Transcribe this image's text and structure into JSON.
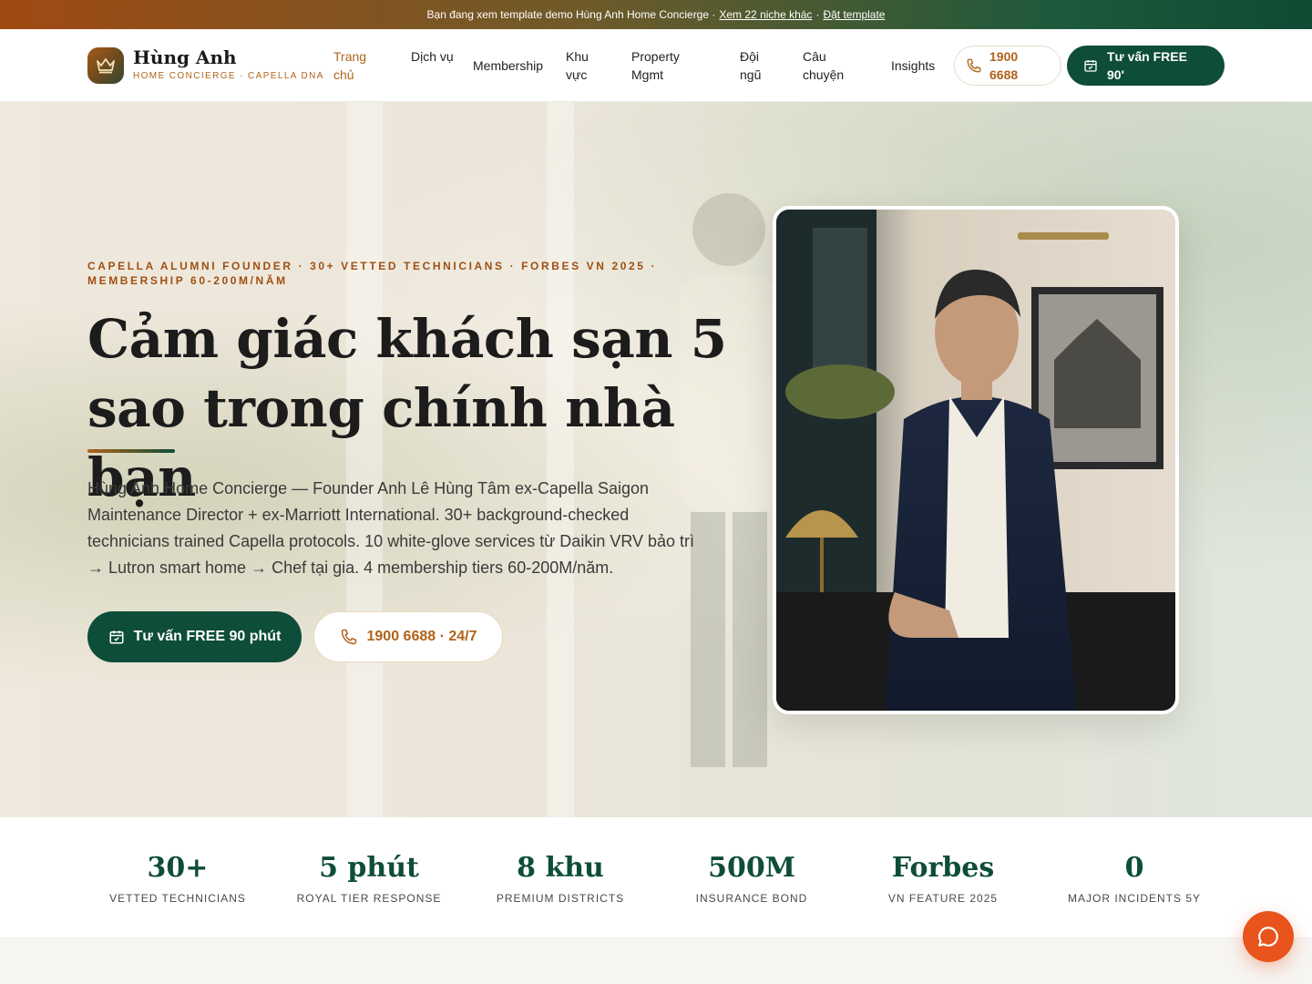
{
  "banner": {
    "text": "Bạn đang xem template demo Hùng Anh Home Concierge ·",
    "link1": "Xem 22 niche khác",
    "sep": "·",
    "link2": "Đặt template"
  },
  "brand": {
    "name": "Hùng Anh",
    "subtitle": "HOME CONCIERGE · CAPELLA DNA",
    "icon": "crown-icon"
  },
  "nav": {
    "items": [
      {
        "label": "Trang chủ",
        "active": true
      },
      {
        "label": "Dịch vụ"
      },
      {
        "label": "Membership"
      },
      {
        "label": "Khu vực"
      },
      {
        "label": "Property Mgmt"
      },
      {
        "label": "Đội ngũ"
      },
      {
        "label": "Câu chuyện"
      },
      {
        "label": "Insights"
      }
    ],
    "phone": "1900 6688",
    "cta": "Tư vấn FREE 90'"
  },
  "hero": {
    "eyebrow": "CAPELLA ALUMNI FOUNDER · 30+ VETTED TECHNICIANS · FORBES VN 2025 · MEMBERSHIP 60-200M/NĂM",
    "headline": "Cảm giác khách sạn 5 sao trong chính nhà bạn",
    "lede": "Hùng Anh Home Concierge — Founder Anh Lê Hùng Tâm ex-Capella Saigon Maintenance Director + ex-Marriott International. 30+ background-checked technicians trained Capella protocols. 10 white-glove services từ Daikin VRV bảo trì → Lutron smart home → Chef tại gia. 4 membership tiers 60-200M/năm.",
    "primary_cta": "Tư vấn FREE 90 phút",
    "secondary_cta": "1900 6688 · 24/7"
  },
  "stats": [
    {
      "value": "30+",
      "label": "VETTED TECHNICIANS"
    },
    {
      "value": "5 phút",
      "label": "ROYAL TIER RESPONSE"
    },
    {
      "value": "8 khu",
      "label": "PREMIUM DISTRICTS"
    },
    {
      "value": "500M",
      "label": "INSURANCE BOND"
    },
    {
      "value": "Forbes",
      "label": "VN FEATURE 2025"
    },
    {
      "value": "0",
      "label": "MAJOR INCIDENTS 5Y"
    }
  ],
  "colors": {
    "accent": "#b0631a",
    "brand_green": "#0e4d3a",
    "chat": "#e8541c"
  }
}
